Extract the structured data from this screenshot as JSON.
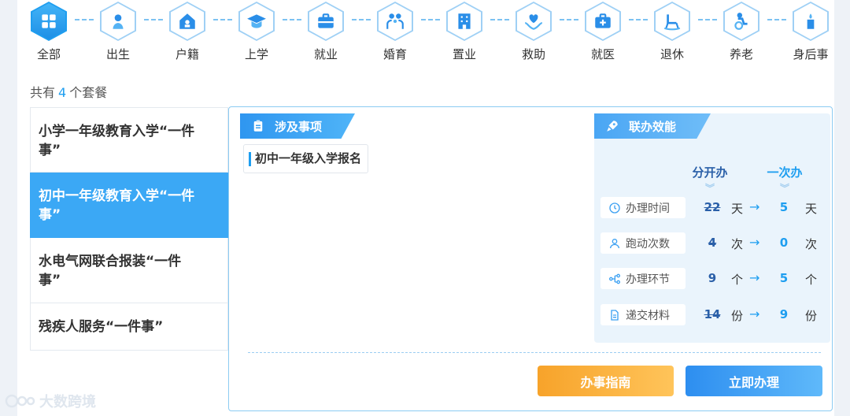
{
  "categories": [
    {
      "label": "全部",
      "icon": "grid-icon",
      "active": true
    },
    {
      "label": "出生",
      "icon": "baby-icon"
    },
    {
      "label": "户籍",
      "icon": "household-icon"
    },
    {
      "label": "上学",
      "icon": "graduation-cap-icon"
    },
    {
      "label": "就业",
      "icon": "briefcase-icon"
    },
    {
      "label": "婚育",
      "icon": "family-icon"
    },
    {
      "label": "置业",
      "icon": "building-icon"
    },
    {
      "label": "救助",
      "icon": "helping-hand-icon"
    },
    {
      "label": "就医",
      "icon": "medical-kit-icon"
    },
    {
      "label": "退休",
      "icon": "rocking-chair-icon"
    },
    {
      "label": "养老",
      "icon": "elderly-care-icon"
    },
    {
      "label": "身后事",
      "icon": "candle-icon"
    }
  ],
  "package_count": {
    "prefix": "共有",
    "count": "4",
    "suffix": "个套餐"
  },
  "packages": [
    {
      "title": "小学一年级教育入学“一件事”"
    },
    {
      "title": "初中一年级教育入学“一件事”",
      "active": true
    },
    {
      "title": "水电气网联合报装“一件事”"
    },
    {
      "title": "残疾人服务“一件事”"
    }
  ],
  "detail": {
    "items_heading": "涉及事项",
    "items": [
      "初中一年级入学报名"
    ],
    "efficiency_heading": "联办效能",
    "col_separate": "分开办",
    "col_once": "一次办",
    "metrics": [
      {
        "label": "办理时间",
        "icon": "clock-icon",
        "before": "22",
        "after": "5",
        "unit": "天"
      },
      {
        "label": "跑动次数",
        "icon": "person-icon",
        "before": "4",
        "after": "0",
        "unit": "次"
      },
      {
        "label": "办理环节",
        "icon": "flow-icon",
        "before": "9",
        "after": "5",
        "unit": "个"
      },
      {
        "label": "递交材料",
        "icon": "document-icon",
        "before": "14",
        "after": "9",
        "unit": "份"
      }
    ],
    "arrow": "→",
    "guide_button": "办事指南",
    "apply_button": "立即办理"
  },
  "watermark": "大数跨境",
  "colors": {
    "accent": "#1e9ef0",
    "guide": "#f7a32a",
    "apply": "#2d8ef0"
  }
}
